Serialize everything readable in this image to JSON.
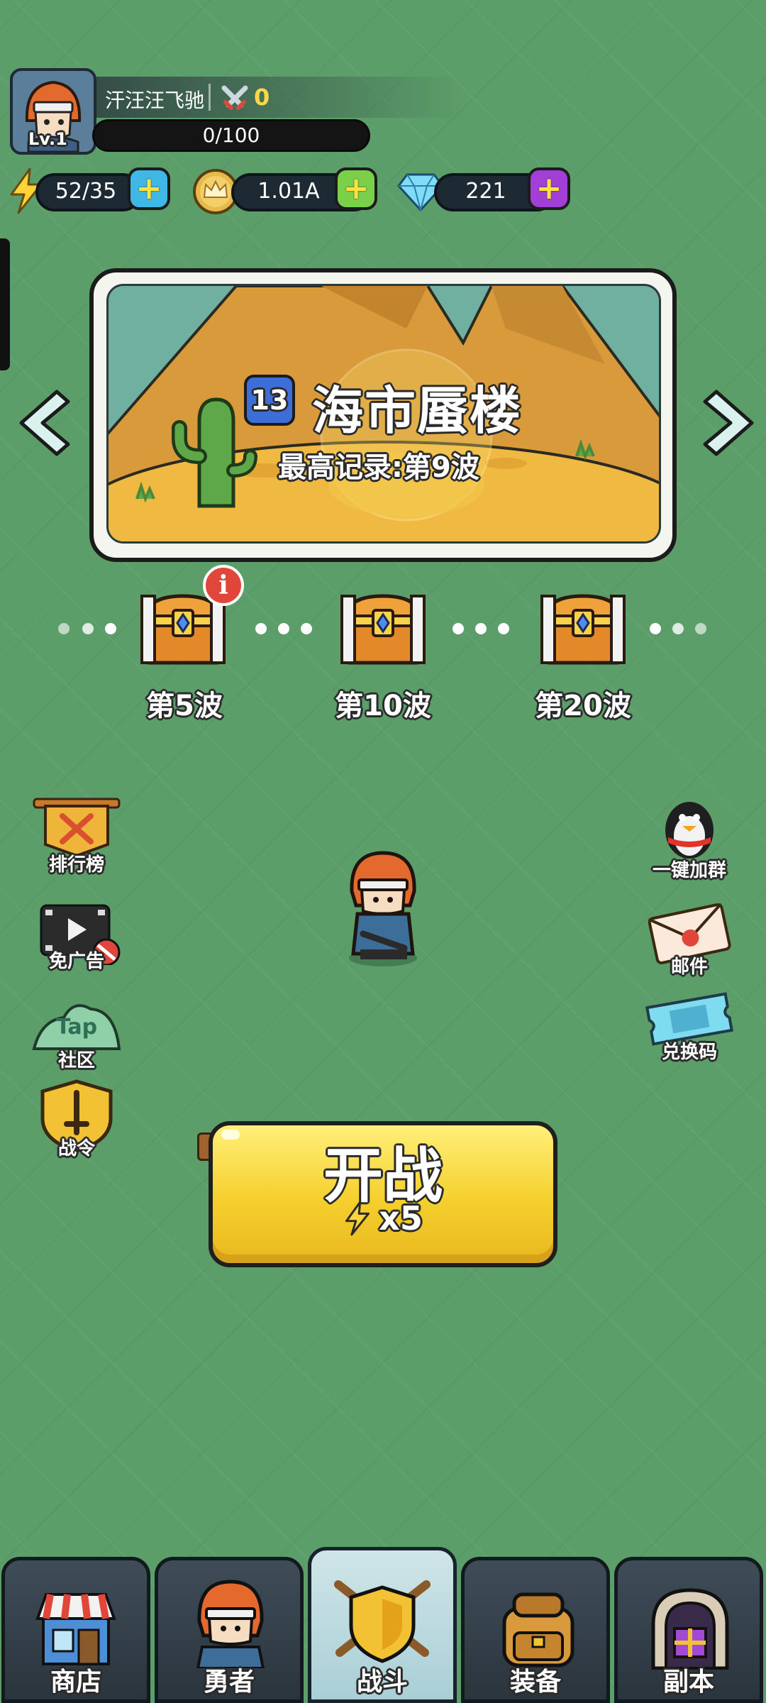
{
  "player": {
    "name": "汗汪汪飞驰",
    "level": "Lv.1",
    "power": "0",
    "xp": "0/100"
  },
  "resources": {
    "energy": "52/35",
    "gold": "1.01A",
    "gems": "221"
  },
  "stage": {
    "number": "13",
    "name": "海市蜃楼",
    "best_record": "最高记录:第9波"
  },
  "rewards": [
    {
      "label": "第5波",
      "has_alert": true
    },
    {
      "label": "第10波",
      "has_alert": false
    },
    {
      "label": "第20波",
      "has_alert": false
    }
  ],
  "left_menu": {
    "leaderboard": "排行榜",
    "no_ads": "免广告",
    "community_tap": "Tap",
    "community": "社区",
    "battle_pass": "战令"
  },
  "right_menu": {
    "join_group": "一键加群",
    "mail": "邮件",
    "redeem_code": "兑换码"
  },
  "battle_button": {
    "label": "开战",
    "cost": "x5"
  },
  "bottom_nav": [
    {
      "label": "商店",
      "active": false
    },
    {
      "label": "勇者",
      "active": false
    },
    {
      "label": "战斗",
      "active": true
    },
    {
      "label": "装备",
      "active": false
    },
    {
      "label": "副本",
      "active": false
    }
  ],
  "colors": {
    "background": "#5c9e6a",
    "battle_button": "#f5cf2c",
    "plus_energy": "#3fb8e8",
    "plus_gold": "#7bd04a",
    "plus_gems": "#a23fd6"
  }
}
